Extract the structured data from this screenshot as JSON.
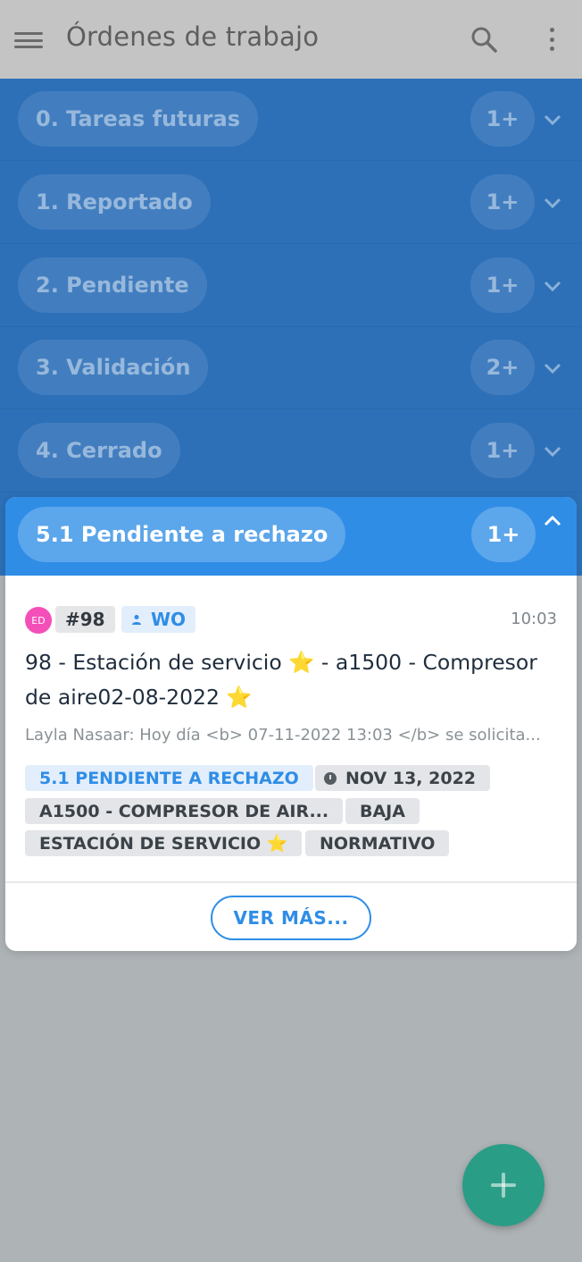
{
  "appbar": {
    "title": "Órdenes de trabajo",
    "menu_icon": "menu-icon",
    "search_icon": "search-icon",
    "more_icon": "more-vertical-icon"
  },
  "groups": [
    {
      "label": "0. Tareas futuras",
      "count": "1+"
    },
    {
      "label": "1. Reportado",
      "count": "1+"
    },
    {
      "label": "2. Pendiente",
      "count": "1+"
    },
    {
      "label": "3. Validación",
      "count": "2+"
    },
    {
      "label": "4. Cerrado",
      "count": "1+"
    }
  ],
  "active_group": {
    "label": "5.1 Pendiente a rechazo",
    "count": "1+"
  },
  "card": {
    "avatar_initials": "ED",
    "number": "#98",
    "type": "WO",
    "time": "10:03",
    "title_part1": "98 - Estación de servicio ",
    "title_star1": "⭐",
    "title_part2": " - a1500 - Compresor de aire02-08-2022 ",
    "title_star2": "⭐",
    "description": "Layla Nasaar: Hoy día <b> 07-11-2022 13:03 </b> se solicita...",
    "tags": {
      "status": "5.1 PENDIENTE A RECHAZO",
      "date": "NOV 13, 2022",
      "asset": "A1500 - COMPRESOR DE AIR...",
      "priority": "BAJA",
      "location": "ESTACIÓN DE SERVICIO ⭐",
      "category": "NORMATIVO"
    }
  },
  "ver_mas_label": "VER MÁS...",
  "colors": {
    "primary": "#2f8de6",
    "group_bg": "#2d70b8",
    "fab": "#2a9d86",
    "avatar": "#f44fb8"
  }
}
